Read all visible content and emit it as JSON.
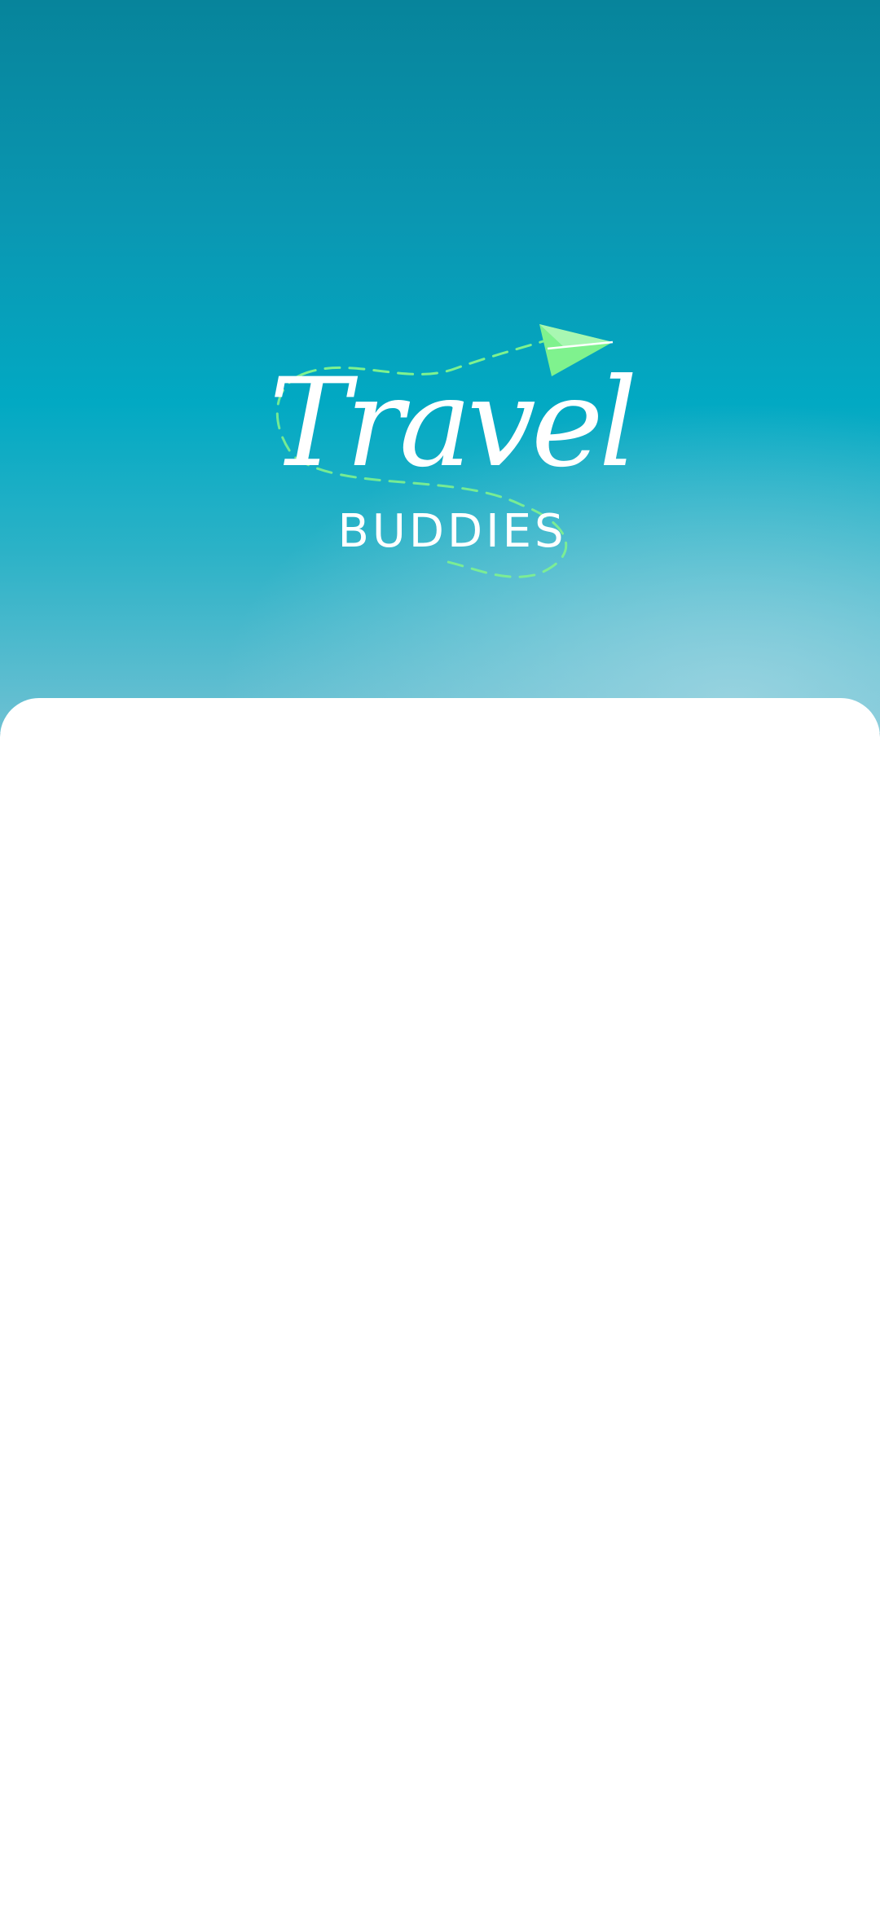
{
  "brand": {
    "name_line_1": "Travel",
    "name_line_2": "BUDDIES",
    "plane_icon": "paper-plane-icon",
    "plane_color": "#7ff28e",
    "trail_color": "#7ff28e"
  },
  "colors": {
    "sky_top": "#07849b",
    "sky_mid": "#02a9c3",
    "sheet": "#ffffff"
  }
}
